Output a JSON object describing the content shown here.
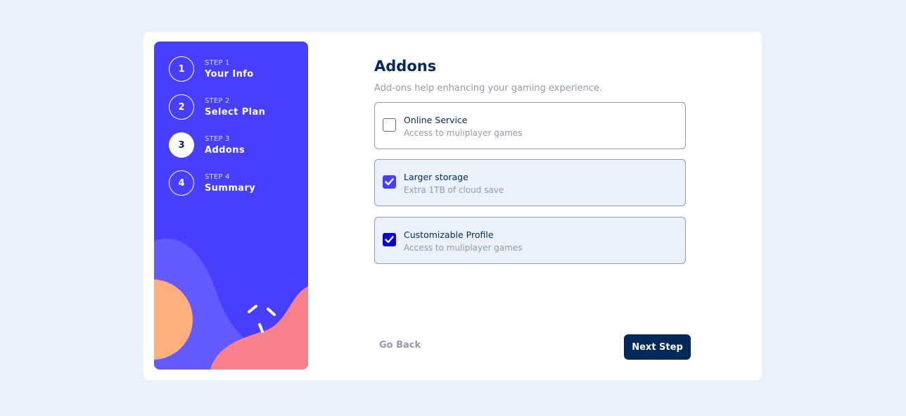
{
  "steps": [
    {
      "number": "1",
      "label": "STEP 1",
      "title": "Your Info",
      "active": false
    },
    {
      "number": "2",
      "label": "STEP 2",
      "title": "Select Plan",
      "active": false
    },
    {
      "number": "3",
      "label": "STEP 3",
      "title": "Addons",
      "active": true
    },
    {
      "number": "4",
      "label": "STEP 4",
      "title": "Summary",
      "active": false
    }
  ],
  "main": {
    "title": "Addons",
    "subtitle": "Add-ons help enhancing your gaming experience.",
    "addons": [
      {
        "name": "Online Service",
        "description": "Access to muliplayer games",
        "checked": false
      },
      {
        "name": "Larger storage",
        "description": "Extra 1TB of cloud save",
        "checked": true,
        "check_color": "#483eff"
      },
      {
        "name": "Customizable Profile",
        "description": "Access to muliplayer games",
        "checked": true,
        "check_color": "#0b00d6"
      }
    ]
  },
  "footer": {
    "back_label": "Go Back",
    "next_label": "Next Step"
  },
  "colors": {
    "page_bg": "#eaf1fb",
    "sidebar": "#483eff",
    "marine_blue": "#022959",
    "grey": "#9699aa",
    "orange": "#ffaf7e",
    "pink": "#f9818e",
    "light_purple": "#6259ff"
  }
}
